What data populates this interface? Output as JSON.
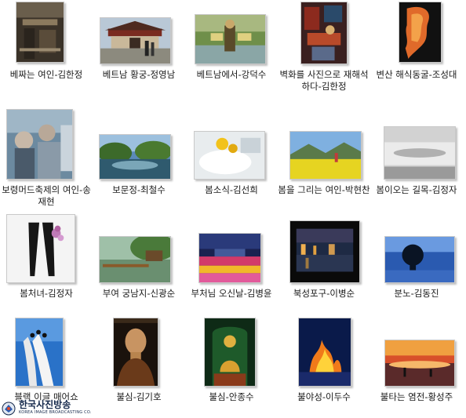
{
  "items": [
    {
      "caption": "베짜는 여인-김한정"
    },
    {
      "caption": "베트남 황궁-정영남"
    },
    {
      "caption": "베트남에서-강덕수"
    },
    {
      "caption": "벽화를 사진으로 재해석하다-김한정"
    },
    {
      "caption": "변산 해식동굴-조성대"
    },
    {
      "caption": "보령머드축제의 여인-송재현"
    },
    {
      "caption": "보문정-최철수"
    },
    {
      "caption": "봄소식-김선희"
    },
    {
      "caption": "봄을 그리는 여인-박현찬"
    },
    {
      "caption": "봄이오는 길목-김정자"
    },
    {
      "caption": "봄처녀-김정자"
    },
    {
      "caption": "부여 궁남지-신광순"
    },
    {
      "caption": "부처님 오신날-김병윤"
    },
    {
      "caption": "북성포구-이병순"
    },
    {
      "caption": "분노-김동진"
    },
    {
      "caption": "블랙 이글 매어쇼"
    },
    {
      "caption": "불심-김기호"
    },
    {
      "caption": "불심-안종수"
    },
    {
      "caption": "불야성-이두수"
    },
    {
      "caption": "불타는 염전-황성주"
    }
  ],
  "watermark": {
    "korean": "한국사진방송",
    "english": "KOREA IMAGE BROADCASTING CO."
  }
}
